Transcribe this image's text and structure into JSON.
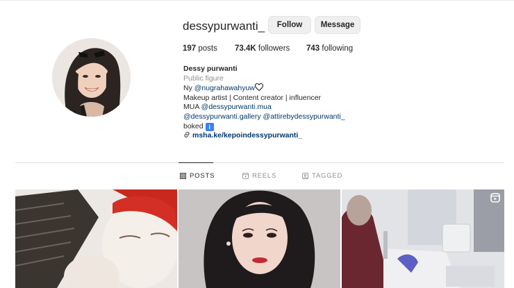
{
  "profile": {
    "username": "dessypurwanti_",
    "follow_label": "Follow",
    "message_label": "Message"
  },
  "stats": {
    "posts_count": "197",
    "posts_label": "posts",
    "followers_count": "73.4K",
    "followers_label": "followers",
    "following_count": "743",
    "following_label": "following"
  },
  "bio": {
    "name": "Dessy purwanti",
    "category": "Public figure",
    "line1_prefix": "Ny ",
    "line1_mention": "@nugrahawahyuw",
    "line2": "Makeup artist | Content creator | influencer",
    "line3_prefix": "MUA ",
    "line3_mention": "@dessypurwanti.mua",
    "line4_mention1": "@dessypurwanti.gallery",
    "line4_mention2": "@attirebydessypurwanti_",
    "line5": "boked",
    "info_glyph": "i",
    "link": "msha.ke/kepoindessypurwanti_"
  },
  "tabs": [
    {
      "label": "POSTS",
      "icon": "grid-icon",
      "active": true
    },
    {
      "label": "REELS",
      "icon": "reels-icon",
      "active": false
    },
    {
      "label": "TAGGED",
      "icon": "tagged-icon",
      "active": false
    }
  ],
  "posts": [
    {
      "subject": "face-mask-selfie"
    },
    {
      "subject": "makeup-portrait"
    },
    {
      "subject": "clinic-treatment",
      "badge": "reels-icon"
    }
  ],
  "colors": {
    "text": "#262626",
    "secondary": "#8e8e8e",
    "link": "#00376b",
    "button_bg": "#efefef",
    "divider": "#dbdbdb"
  }
}
